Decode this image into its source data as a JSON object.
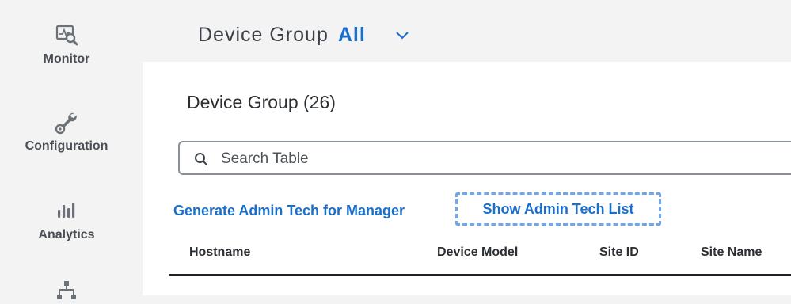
{
  "sidebar": {
    "items": [
      {
        "label": "Monitor",
        "icon": "monitor-icon"
      },
      {
        "label": "Configuration",
        "icon": "wrench-gear-icon"
      },
      {
        "label": "Analytics",
        "icon": "bar-chart-icon"
      },
      {
        "label": "",
        "icon": "workflow-icon"
      }
    ]
  },
  "header": {
    "selector_label": "Device Group",
    "selector_value": "All"
  },
  "main": {
    "title": "Device Group (26)",
    "search": {
      "placeholder": "Search Table",
      "value": ""
    },
    "actions": {
      "generate_label": "Generate Admin Tech for Manager",
      "show_label": "Show Admin Tech List"
    },
    "table": {
      "columns": [
        "Hostname",
        "Device Model",
        "Site ID",
        "Site Name"
      ]
    }
  },
  "colors": {
    "accent": "#1a6fcb",
    "focus_outline": "#6ea6f0",
    "icon_gray": "#6b7178"
  }
}
